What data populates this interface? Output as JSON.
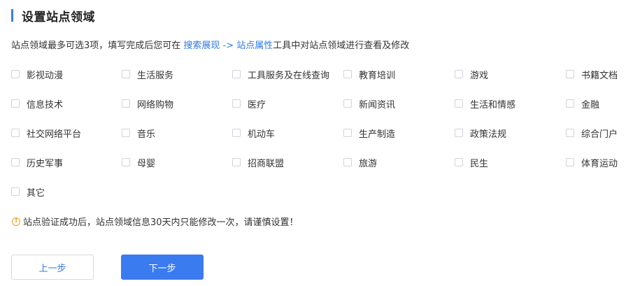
{
  "header": {
    "title": "设置站点领域"
  },
  "intro": {
    "text_before": "站点领域最多可选3项，填写完成后您可在",
    "link": "搜索展现 -> 站点属性",
    "text_after": "工具中对站点领域进行查看及修改"
  },
  "options": [
    [
      "影视动漫",
      "生活服务",
      "工具服务及在线查询",
      "教育培训",
      "游戏",
      "书籍文档"
    ],
    [
      "信息技术",
      "网络购物",
      "医疗",
      "新闻资讯",
      "生活和情感",
      "金融"
    ],
    [
      "社交网络平台",
      "音乐",
      "机动车",
      "生产制造",
      "政策法规",
      "综合门户"
    ],
    [
      "历史军事",
      "母婴",
      "招商联盟",
      "旅游",
      "民生",
      "体育运动"
    ],
    [
      "其它"
    ]
  ],
  "warning": {
    "text": "站点验证成功后，站点领域信息30天内只能修改一次，请谨慎设置！"
  },
  "buttons": {
    "prev": "上一步",
    "next": "下一步"
  }
}
